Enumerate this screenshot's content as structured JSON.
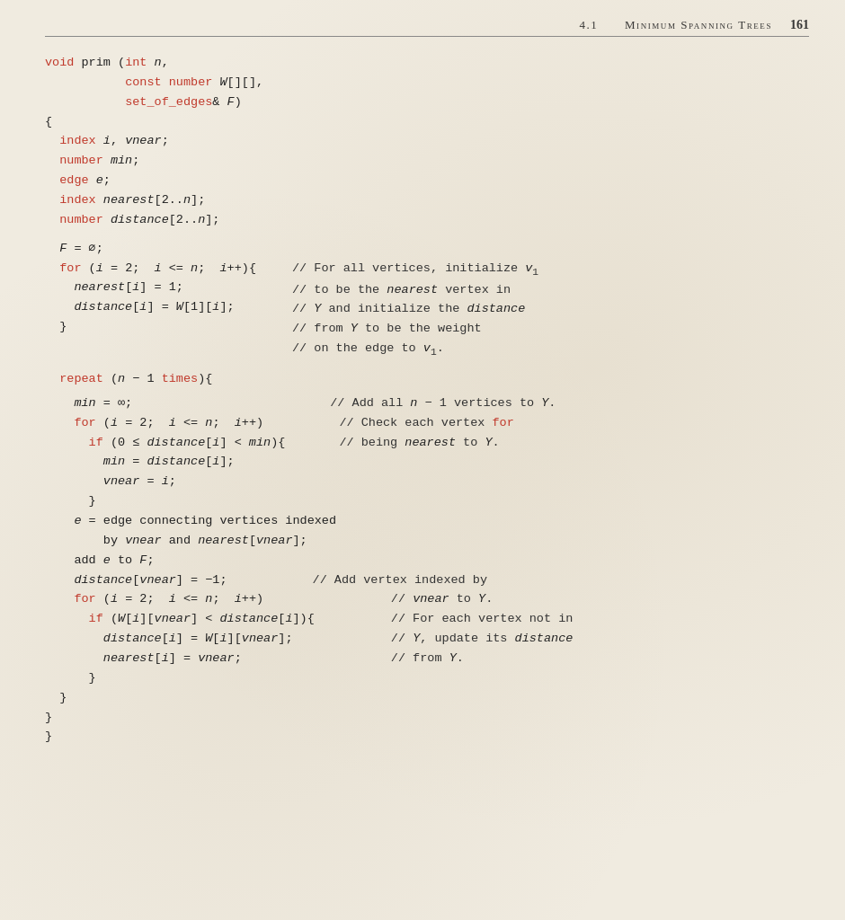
{
  "header": {
    "section": "4.1",
    "title": "Minimum Spanning Trees",
    "page": "161"
  },
  "code": {
    "lines": [
      "void prim (int n,",
      "           const number W[][],",
      "           set_of_edges& F)",
      "{",
      "  index i, vnear;",
      "  number min;",
      "  edge e;",
      "  index nearest[2..n];",
      "  number distance[2..n];",
      "",
      "  F = ∅;",
      "  for (i = 2;  i <= n;  i++){",
      "    nearest[i] = 1;",
      "    distance[i] = W[1][i];",
      "  }",
      "",
      "  repeat (n − 1 times){",
      "",
      "    min = ∞;",
      "    for (i = 2;  i <= n;  i++)",
      "      if (0 ≤ distance[i] < min){",
      "        min = distance[i];",
      "        vnear = i;",
      "      }",
      "    e = edge connecting vertices indexed",
      "        by vnear and nearest[vnear];",
      "    add e to F;",
      "    distance[vnear] = −1;",
      "    for (i = 2;  i <= n;  i++)",
      "      if (W[i][vnear] < distance[i]){",
      "        distance[i] = W[i][vnear];",
      "        nearest[i] = vnear;",
      "      }",
      "  }",
      "}",
      "}"
    ],
    "comments": {
      "nearest_init": "// For all vertices, initialize v₁",
      "nearest_init2": "// to be the nearest vertex in",
      "nearest_init3": "// Y and initialize the distance",
      "nearest_init4": "// from Y to be the weight",
      "nearest_init5": "// on the edge to v₁.",
      "add_all": "// Add all n − 1 vertices to Y.",
      "check_each": "// Check each vertex for",
      "check_each2": "// being nearest to Y.",
      "add_vertex": "// Add vertex indexed by",
      "add_vertex2": "// vnear to Y.",
      "for_each": "// For each vertex not in",
      "for_each2": "// Y, update its distance",
      "for_each3": "// from Y."
    }
  }
}
